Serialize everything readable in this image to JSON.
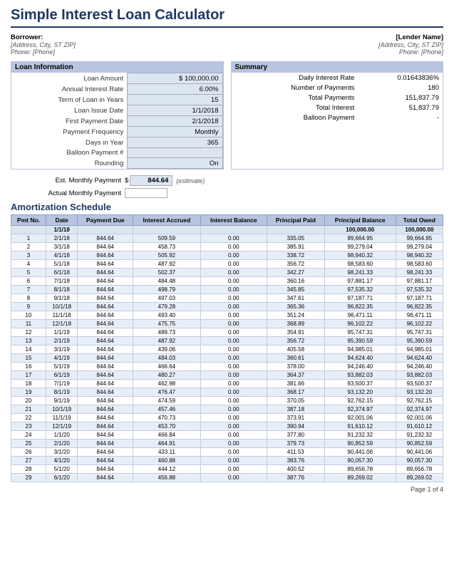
{
  "title": "Simple Interest Loan Calculator",
  "borrower": {
    "label": "Borrower:",
    "address": "[Address, City, ST ZIP]",
    "phone": "Phone: [Phone]"
  },
  "lender": {
    "name": "[Lender Name]",
    "address": "[Address, City, ST ZIP]",
    "phone": "Phone: [Phone]"
  },
  "loan_info": {
    "header": "Loan Information",
    "fields": [
      {
        "label": "Loan Amount",
        "value": "$ 100,000.00"
      },
      {
        "label": "Annual Interest Rate",
        "value": "6.00%"
      },
      {
        "label": "Term of Loan in Years",
        "value": "15"
      },
      {
        "label": "Loan Issue Date",
        "value": "1/1/2018"
      },
      {
        "label": "First Payment Date",
        "value": "2/1/2018"
      },
      {
        "label": "Payment Frequency",
        "value": "Monthly"
      },
      {
        "label": "Days in Year",
        "value": "365"
      },
      {
        "label": "Balloon Payment #",
        "value": ""
      },
      {
        "label": "Rounding",
        "value": "On"
      }
    ]
  },
  "summary": {
    "header": "Summary",
    "fields": [
      {
        "label": "Daily Interest Rate",
        "value": "0.01643836%"
      },
      {
        "label": "Number of Payments",
        "value": "180"
      },
      {
        "label": "Total Payments",
        "value": "151,837.79"
      },
      {
        "label": "Total Interest",
        "value": "51,837.79"
      },
      {
        "label": "Balloon Payment",
        "value": "-"
      }
    ]
  },
  "est_monthly": {
    "label": "Est. Monthly Payment",
    "dollar": "$",
    "value": "844.64",
    "note": "(estimate)"
  },
  "actual_monthly": {
    "label": "Actual Monthly Payment",
    "value": ""
  },
  "amortization": {
    "title": "Amortization Schedule",
    "columns": [
      "Pmt No.",
      "Date",
      "Payment Due",
      "Interest Accrued",
      "Interest Balance",
      "Principal Paid",
      "Principal Balance",
      "Total Owed"
    ],
    "rows": [
      {
        "pmt": "",
        "date": "1/1/18",
        "payment": "",
        "interest_acc": "",
        "interest_bal": "",
        "principal_paid": "",
        "principal_bal": "100,000.00",
        "total_owed": "100,000.00"
      },
      {
        "pmt": "1",
        "date": "2/1/18",
        "payment": "844.64",
        "interest_acc": "509.59",
        "interest_bal": "0.00",
        "principal_paid": "335.05",
        "principal_bal": "99,664.95",
        "total_owed": "99,664.95"
      },
      {
        "pmt": "2",
        "date": "3/1/18",
        "payment": "844.64",
        "interest_acc": "458.73",
        "interest_bal": "0.00",
        "principal_paid": "385.91",
        "principal_bal": "99,279.04",
        "total_owed": "99,279.04"
      },
      {
        "pmt": "3",
        "date": "4/1/18",
        "payment": "844.64",
        "interest_acc": "505.92",
        "interest_bal": "0.00",
        "principal_paid": "338.72",
        "principal_bal": "98,940.32",
        "total_owed": "98,940.32"
      },
      {
        "pmt": "4",
        "date": "5/1/18",
        "payment": "844.64",
        "interest_acc": "487.92",
        "interest_bal": "0.00",
        "principal_paid": "356.72",
        "principal_bal": "98,583.60",
        "total_owed": "98,583.60"
      },
      {
        "pmt": "5",
        "date": "6/1/18",
        "payment": "844.64",
        "interest_acc": "502.37",
        "interest_bal": "0.00",
        "principal_paid": "342.27",
        "principal_bal": "98,241.33",
        "total_owed": "98,241.33"
      },
      {
        "pmt": "6",
        "date": "7/1/18",
        "payment": "844.64",
        "interest_acc": "484.48",
        "interest_bal": "0.00",
        "principal_paid": "360.16",
        "principal_bal": "97,881.17",
        "total_owed": "97,881.17"
      },
      {
        "pmt": "7",
        "date": "8/1/18",
        "payment": "844.64",
        "interest_acc": "498.79",
        "interest_bal": "0.00",
        "principal_paid": "345.85",
        "principal_bal": "97,535.32",
        "total_owed": "97,535.32"
      },
      {
        "pmt": "8",
        "date": "9/1/18",
        "payment": "844.64",
        "interest_acc": "497.03",
        "interest_bal": "0.00",
        "principal_paid": "347.61",
        "principal_bal": "97,187.71",
        "total_owed": "97,187.71"
      },
      {
        "pmt": "9",
        "date": "10/1/18",
        "payment": "844.64",
        "interest_acc": "479.28",
        "interest_bal": "0.00",
        "principal_paid": "365.36",
        "principal_bal": "96,822.35",
        "total_owed": "96,822.35"
      },
      {
        "pmt": "10",
        "date": "11/1/18",
        "payment": "844.64",
        "interest_acc": "493.40",
        "interest_bal": "0.00",
        "principal_paid": "351.24",
        "principal_bal": "96,471.11",
        "total_owed": "96,471.11"
      },
      {
        "pmt": "11",
        "date": "12/1/18",
        "payment": "844.64",
        "interest_acc": "475.75",
        "interest_bal": "0.00",
        "principal_paid": "368.89",
        "principal_bal": "96,102.22",
        "total_owed": "96,102.22"
      },
      {
        "pmt": "12",
        "date": "1/1/19",
        "payment": "844.64",
        "interest_acc": "489.73",
        "interest_bal": "0.00",
        "principal_paid": "354.91",
        "principal_bal": "95,747.31",
        "total_owed": "95,747.31"
      },
      {
        "pmt": "13",
        "date": "2/1/19",
        "payment": "844.64",
        "interest_acc": "487.92",
        "interest_bal": "0.00",
        "principal_paid": "356.72",
        "principal_bal": "95,390.59",
        "total_owed": "95,390.59"
      },
      {
        "pmt": "14",
        "date": "3/1/19",
        "payment": "844.64",
        "interest_acc": "439.06",
        "interest_bal": "0.00",
        "principal_paid": "405.58",
        "principal_bal": "94,985.01",
        "total_owed": "94,985.01"
      },
      {
        "pmt": "15",
        "date": "4/1/19",
        "payment": "844.64",
        "interest_acc": "484.03",
        "interest_bal": "0.00",
        "principal_paid": "360.61",
        "principal_bal": "94,624.40",
        "total_owed": "94,624.40"
      },
      {
        "pmt": "16",
        "date": "5/1/19",
        "payment": "844.64",
        "interest_acc": "466.64",
        "interest_bal": "0.00",
        "principal_paid": "378.00",
        "principal_bal": "94,246.40",
        "total_owed": "94,246.40"
      },
      {
        "pmt": "17",
        "date": "6/1/19",
        "payment": "844.64",
        "interest_acc": "480.27",
        "interest_bal": "0.00",
        "principal_paid": "364.37",
        "principal_bal": "93,882.03",
        "total_owed": "93,882.03"
      },
      {
        "pmt": "18",
        "date": "7/1/19",
        "payment": "844.64",
        "interest_acc": "462.98",
        "interest_bal": "0.00",
        "principal_paid": "381.66",
        "principal_bal": "93,500.37",
        "total_owed": "93,500.37"
      },
      {
        "pmt": "19",
        "date": "8/1/19",
        "payment": "844.64",
        "interest_acc": "476.47",
        "interest_bal": "0.00",
        "principal_paid": "368.17",
        "principal_bal": "93,132.20",
        "total_owed": "93,132.20"
      },
      {
        "pmt": "20",
        "date": "9/1/19",
        "payment": "844.64",
        "interest_acc": "474.59",
        "interest_bal": "0.00",
        "principal_paid": "370.05",
        "principal_bal": "92,762.15",
        "total_owed": "92,762.15"
      },
      {
        "pmt": "21",
        "date": "10/1/19",
        "payment": "844.64",
        "interest_acc": "457.46",
        "interest_bal": "0.00",
        "principal_paid": "387.18",
        "principal_bal": "92,374.97",
        "total_owed": "92,374.97"
      },
      {
        "pmt": "22",
        "date": "11/1/19",
        "payment": "844.64",
        "interest_acc": "470.73",
        "interest_bal": "0.00",
        "principal_paid": "373.91",
        "principal_bal": "92,001.06",
        "total_owed": "92,001.06"
      },
      {
        "pmt": "23",
        "date": "12/1/19",
        "payment": "844.64",
        "interest_acc": "453.70",
        "interest_bal": "0.00",
        "principal_paid": "390.94",
        "principal_bal": "91,610.12",
        "total_owed": "91,610.12"
      },
      {
        "pmt": "24",
        "date": "1/1/20",
        "payment": "844.64",
        "interest_acc": "466.84",
        "interest_bal": "0.00",
        "principal_paid": "377.80",
        "principal_bal": "91,232.32",
        "total_owed": "91,232.32"
      },
      {
        "pmt": "25",
        "date": "2/1/20",
        "payment": "844.64",
        "interest_acc": "464.91",
        "interest_bal": "0.00",
        "principal_paid": "379.73",
        "principal_bal": "90,852.59",
        "total_owed": "90,852.59"
      },
      {
        "pmt": "26",
        "date": "3/1/20",
        "payment": "844.64",
        "interest_acc": "433.11",
        "interest_bal": "0.00",
        "principal_paid": "411.53",
        "principal_bal": "90,441.06",
        "total_owed": "90,441.06"
      },
      {
        "pmt": "27",
        "date": "4/1/20",
        "payment": "844.64",
        "interest_acc": "460.88",
        "interest_bal": "0.00",
        "principal_paid": "383.76",
        "principal_bal": "90,057.30",
        "total_owed": "90,057.30"
      },
      {
        "pmt": "28",
        "date": "5/1/20",
        "payment": "844.64",
        "interest_acc": "444.12",
        "interest_bal": "0.00",
        "principal_paid": "400.52",
        "principal_bal": "89,656.78",
        "total_owed": "89,656.78"
      },
      {
        "pmt": "29",
        "date": "6/1/20",
        "payment": "844.64",
        "interest_acc": "456.88",
        "interest_bal": "0.00",
        "principal_paid": "387.76",
        "principal_bal": "89,269.02",
        "total_owed": "89,269.02"
      }
    ]
  },
  "page_num": "Page 1 of 4"
}
